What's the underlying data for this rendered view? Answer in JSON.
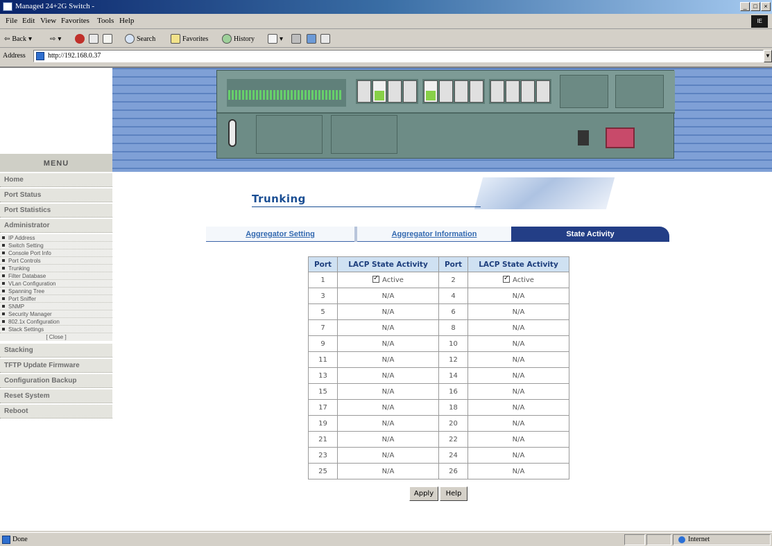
{
  "window": {
    "title": "Managed 24+2G Switch -"
  },
  "menubar": [
    "File",
    "Edit",
    "View",
    "Favorites",
    "Tools",
    "Help"
  ],
  "toolbar": {
    "back": "Back",
    "search": "Search",
    "favorites": "Favorites",
    "history": "History"
  },
  "address": {
    "label": "Address",
    "url": "http://192.168.0.37"
  },
  "sidebar": {
    "header": "MENU",
    "top_items": [
      "Home",
      "Port Status",
      "Port Statistics",
      "Administrator"
    ],
    "sub_items": [
      "IP Address",
      "Switch Setting",
      "Console Port Info",
      "Port Controls",
      "Trunking",
      "Filter Database",
      "VLan Configuration",
      "Spanning Tree",
      "Port Sniffer",
      "SNMP",
      "Security Manager",
      "802.1x Configuration",
      "Stack Settings"
    ],
    "close": "[ Close ]",
    "bottom_items": [
      "Stacking",
      "TFTP Update Firmware",
      "Configuration Backup",
      "Reset System",
      "Reboot"
    ]
  },
  "page": {
    "title": "Trunking"
  },
  "tabs": [
    {
      "label": "Aggregator Setting",
      "active": false
    },
    {
      "label": "Aggregator Information",
      "active": false
    },
    {
      "label": "State Activity",
      "active": true
    }
  ],
  "table": {
    "headers": [
      "Port",
      "LACP State Activity",
      "Port",
      "LACP State Activity"
    ],
    "rows": [
      {
        "p1": "1",
        "s1": "Active",
        "c1": true,
        "p2": "2",
        "s2": "Active",
        "c2": true
      },
      {
        "p1": "3",
        "s1": "N/A",
        "p2": "4",
        "s2": "N/A"
      },
      {
        "p1": "5",
        "s1": "N/A",
        "p2": "6",
        "s2": "N/A"
      },
      {
        "p1": "7",
        "s1": "N/A",
        "p2": "8",
        "s2": "N/A"
      },
      {
        "p1": "9",
        "s1": "N/A",
        "p2": "10",
        "s2": "N/A"
      },
      {
        "p1": "11",
        "s1": "N/A",
        "p2": "12",
        "s2": "N/A"
      },
      {
        "p1": "13",
        "s1": "N/A",
        "p2": "14",
        "s2": "N/A"
      },
      {
        "p1": "15",
        "s1": "N/A",
        "p2": "16",
        "s2": "N/A"
      },
      {
        "p1": "17",
        "s1": "N/A",
        "p2": "18",
        "s2": "N/A"
      },
      {
        "p1": "19",
        "s1": "N/A",
        "p2": "20",
        "s2": "N/A"
      },
      {
        "p1": "21",
        "s1": "N/A",
        "p2": "22",
        "s2": "N/A"
      },
      {
        "p1": "23",
        "s1": "N/A",
        "p2": "24",
        "s2": "N/A"
      },
      {
        "p1": "25",
        "s1": "N/A",
        "p2": "26",
        "s2": "N/A"
      }
    ]
  },
  "buttons": {
    "apply": "Apply",
    "help": "Help"
  },
  "status": {
    "text": "Done",
    "zone": "Internet"
  },
  "colors": {
    "title_blue": "#1a4e93",
    "tab_active": "#233e86",
    "header_bg": "#cfe1f2",
    "banner": "#6b8fc9"
  }
}
